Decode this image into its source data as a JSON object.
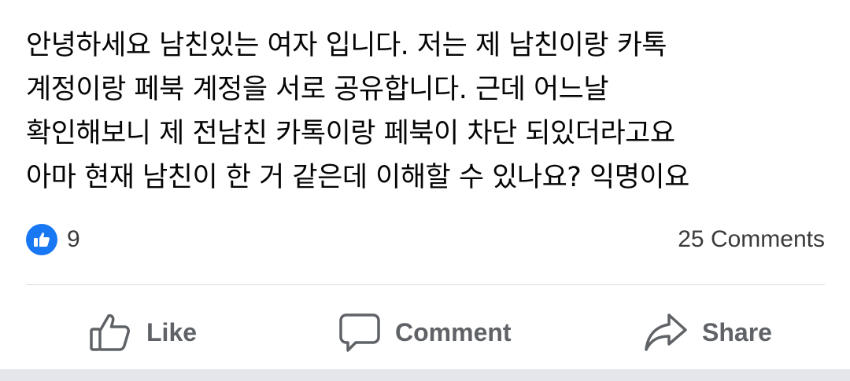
{
  "post": {
    "text": "안녕하세요 남친있는 여자 입니다. 저는 제 남친이랑 카톡\n계정이랑 페북 계정을 서로 공유합니다. 근데 어느날\n확인해보니 제 전남친 카톡이랑 페북이 차단 되있더라고요\n아마 현재 남친이 한 거 같은데 이해할 수 있나요? 익명이요"
  },
  "stats": {
    "like_count": "9",
    "comments_label": "25 Comments"
  },
  "actions": {
    "like_label": "Like",
    "comment_label": "Comment",
    "share_label": "Share"
  },
  "icons": {
    "like_badge": "thumbs-up-icon",
    "like": "thumbs-up-outline-icon",
    "comment": "speech-bubble-icon",
    "share": "share-arrow-icon"
  },
  "colors": {
    "brand_blue": "#1877f2",
    "action_gray": "#5f6266"
  }
}
